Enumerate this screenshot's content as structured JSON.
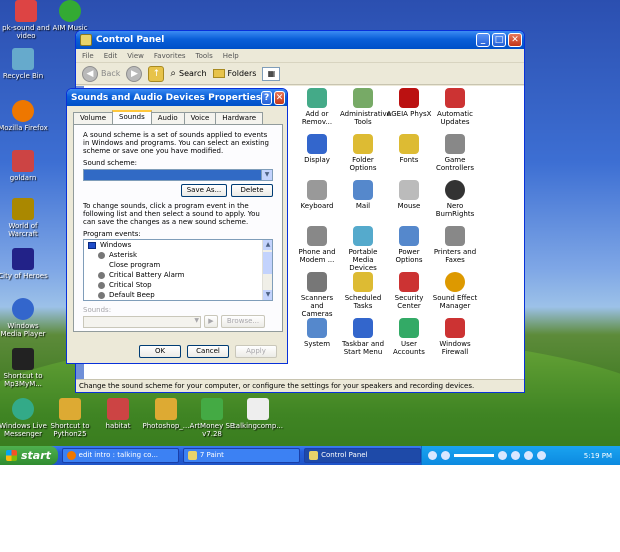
{
  "desktop": {
    "icons": [
      {
        "label": "pk-sound and video",
        "color": "#d44"
      },
      {
        "label": "AIM Music",
        "color": "#3a3"
      },
      {
        "label": "Recycle Bin",
        "color": "#6ac"
      },
      {
        "label": "Mozilla Firefox",
        "color": "#e70"
      },
      {
        "label": "goldarn",
        "color": "#c44"
      },
      {
        "label": "World of Warcraft",
        "color": "#a80"
      },
      {
        "label": "City of Heroes",
        "color": "#228"
      },
      {
        "label": "Windows Media Player",
        "color": "#36c"
      },
      {
        "label": "Shortcut to Mp3MyM...",
        "color": "#222"
      },
      {
        "label": "Windows Live Messenger",
        "color": "#3a8"
      },
      {
        "label": "Shortcut to Python25",
        "color": "#da3"
      },
      {
        "label": "habitat",
        "color": "#c44"
      },
      {
        "label": "Photoshop_...",
        "color": "#da3"
      },
      {
        "label": "ArtMoney SE v7.28",
        "color": "#4a4"
      },
      {
        "label": "talkingcomp...",
        "color": "#eee"
      }
    ]
  },
  "control_panel": {
    "title": "Control Panel",
    "menu": [
      "File",
      "Edit",
      "View",
      "Favorites",
      "Tools",
      "Help"
    ],
    "toolbar": {
      "back": "Back",
      "search": "Search",
      "folders": "Folders"
    },
    "items": [
      {
        "label": "Add or Remov...",
        "color": "#4a8"
      },
      {
        "label": "Administrative Tools",
        "color": "#7a6"
      },
      {
        "label": "AGEIA PhysX",
        "color": "#b11"
      },
      {
        "label": "Automatic Updates",
        "color": "#c33"
      },
      {
        "label": "Display",
        "color": "#36c"
      },
      {
        "label": "Folder Options",
        "color": "#db3"
      },
      {
        "label": "Fonts",
        "color": "#db3"
      },
      {
        "label": "Game Controllers",
        "color": "#888"
      },
      {
        "label": "Keyboard",
        "color": "#999"
      },
      {
        "label": "Mail",
        "color": "#58c"
      },
      {
        "label": "Mouse",
        "color": "#bbb"
      },
      {
        "label": "Nero BurnRights",
        "color": "#333"
      },
      {
        "label": "Phone and Modem ...",
        "color": "#888"
      },
      {
        "label": "Portable Media Devices",
        "color": "#5ac"
      },
      {
        "label": "Power Options",
        "color": "#58c"
      },
      {
        "label": "Printers and Faxes",
        "color": "#888"
      },
      {
        "label": "Scanners and Cameras",
        "color": "#777"
      },
      {
        "label": "Scheduled Tasks",
        "color": "#db3"
      },
      {
        "label": "Security Center",
        "color": "#c33"
      },
      {
        "label": "Sound Effect Manager",
        "color": "#d90"
      },
      {
        "label": "System",
        "color": "#58c"
      },
      {
        "label": "Taskbar and Start Menu",
        "color": "#36c"
      },
      {
        "label": "User Accounts",
        "color": "#3a6"
      },
      {
        "label": "Windows Firewall",
        "color": "#c33"
      }
    ],
    "status": "Change the sound scheme for your computer, or configure the settings for your speakers and recording devices."
  },
  "sounds_dialog": {
    "title": "Sounds and Audio Devices Properties",
    "tabs": [
      "Volume",
      "Sounds",
      "Audio",
      "Voice",
      "Hardware"
    ],
    "active_tab": "Sounds",
    "scheme_description": "A sound scheme is a set of sounds applied to events in Windows and programs. You can select an existing scheme or save one you have modified.",
    "scheme_label": "Sound scheme:",
    "save_as": "Save As...",
    "delete": "Delete",
    "change_description": "To change sounds, click a program event in the following list and then select a sound to apply. You can save the changes as a new sound scheme.",
    "events_label": "Program events:",
    "events": [
      {
        "label": "Windows",
        "type": "group"
      },
      {
        "label": "Asterisk",
        "type": "sound"
      },
      {
        "label": "Close program",
        "type": "none"
      },
      {
        "label": "Critical Battery Alarm",
        "type": "sound"
      },
      {
        "label": "Critical Stop",
        "type": "sound"
      },
      {
        "label": "Default Beep",
        "type": "sound"
      }
    ],
    "sounds_label": "Sounds:",
    "browse": "Browse...",
    "ok": "OK",
    "cancel": "Cancel",
    "apply": "Apply"
  },
  "taskbar": {
    "start": "start",
    "tasks": [
      "edit intro : talking co...",
      "7 Paint",
      "Control Panel"
    ],
    "active_task": "Control Panel",
    "clock": "5:19 PM"
  }
}
